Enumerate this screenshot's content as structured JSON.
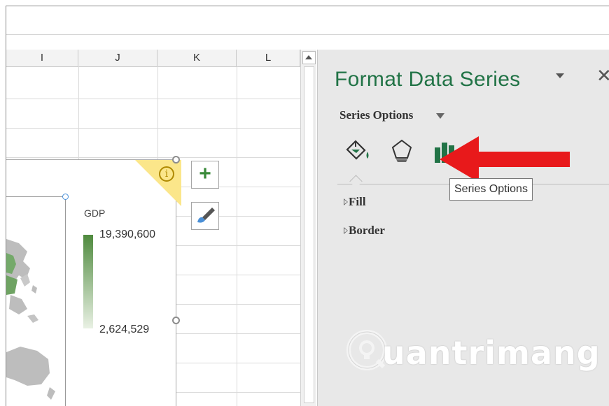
{
  "sheet": {
    "columns": [
      "I",
      "J",
      "K",
      "L"
    ]
  },
  "chart": {
    "legend_title": "GDP",
    "legend_max": "19,390,600",
    "legend_min": "2,624,529",
    "info_glyph": "i",
    "colors": {
      "legend_high": "#4f8a3e",
      "legend_low": "#e9f1e4",
      "map_land": "#bdbdbd",
      "map_highlight": "#74a96a"
    }
  },
  "side_buttons": {
    "add_glyph": "+",
    "style_icon": "paintbrush-icon"
  },
  "pane": {
    "title": "Format Data Series",
    "close_glyph": "✕",
    "series_options_label": "Series Options",
    "tabs": [
      {
        "icon": "paint-bucket-icon"
      },
      {
        "icon": "pentagon-icon"
      },
      {
        "icon": "bar-chart-icon"
      }
    ],
    "sections": [
      "Fill",
      "Border"
    ],
    "tooltip": "Series Options",
    "accent_color": "#217346"
  },
  "watermark": {
    "text": "uantrimang"
  },
  "annotation": {
    "arrow_color": "#e8191b"
  }
}
